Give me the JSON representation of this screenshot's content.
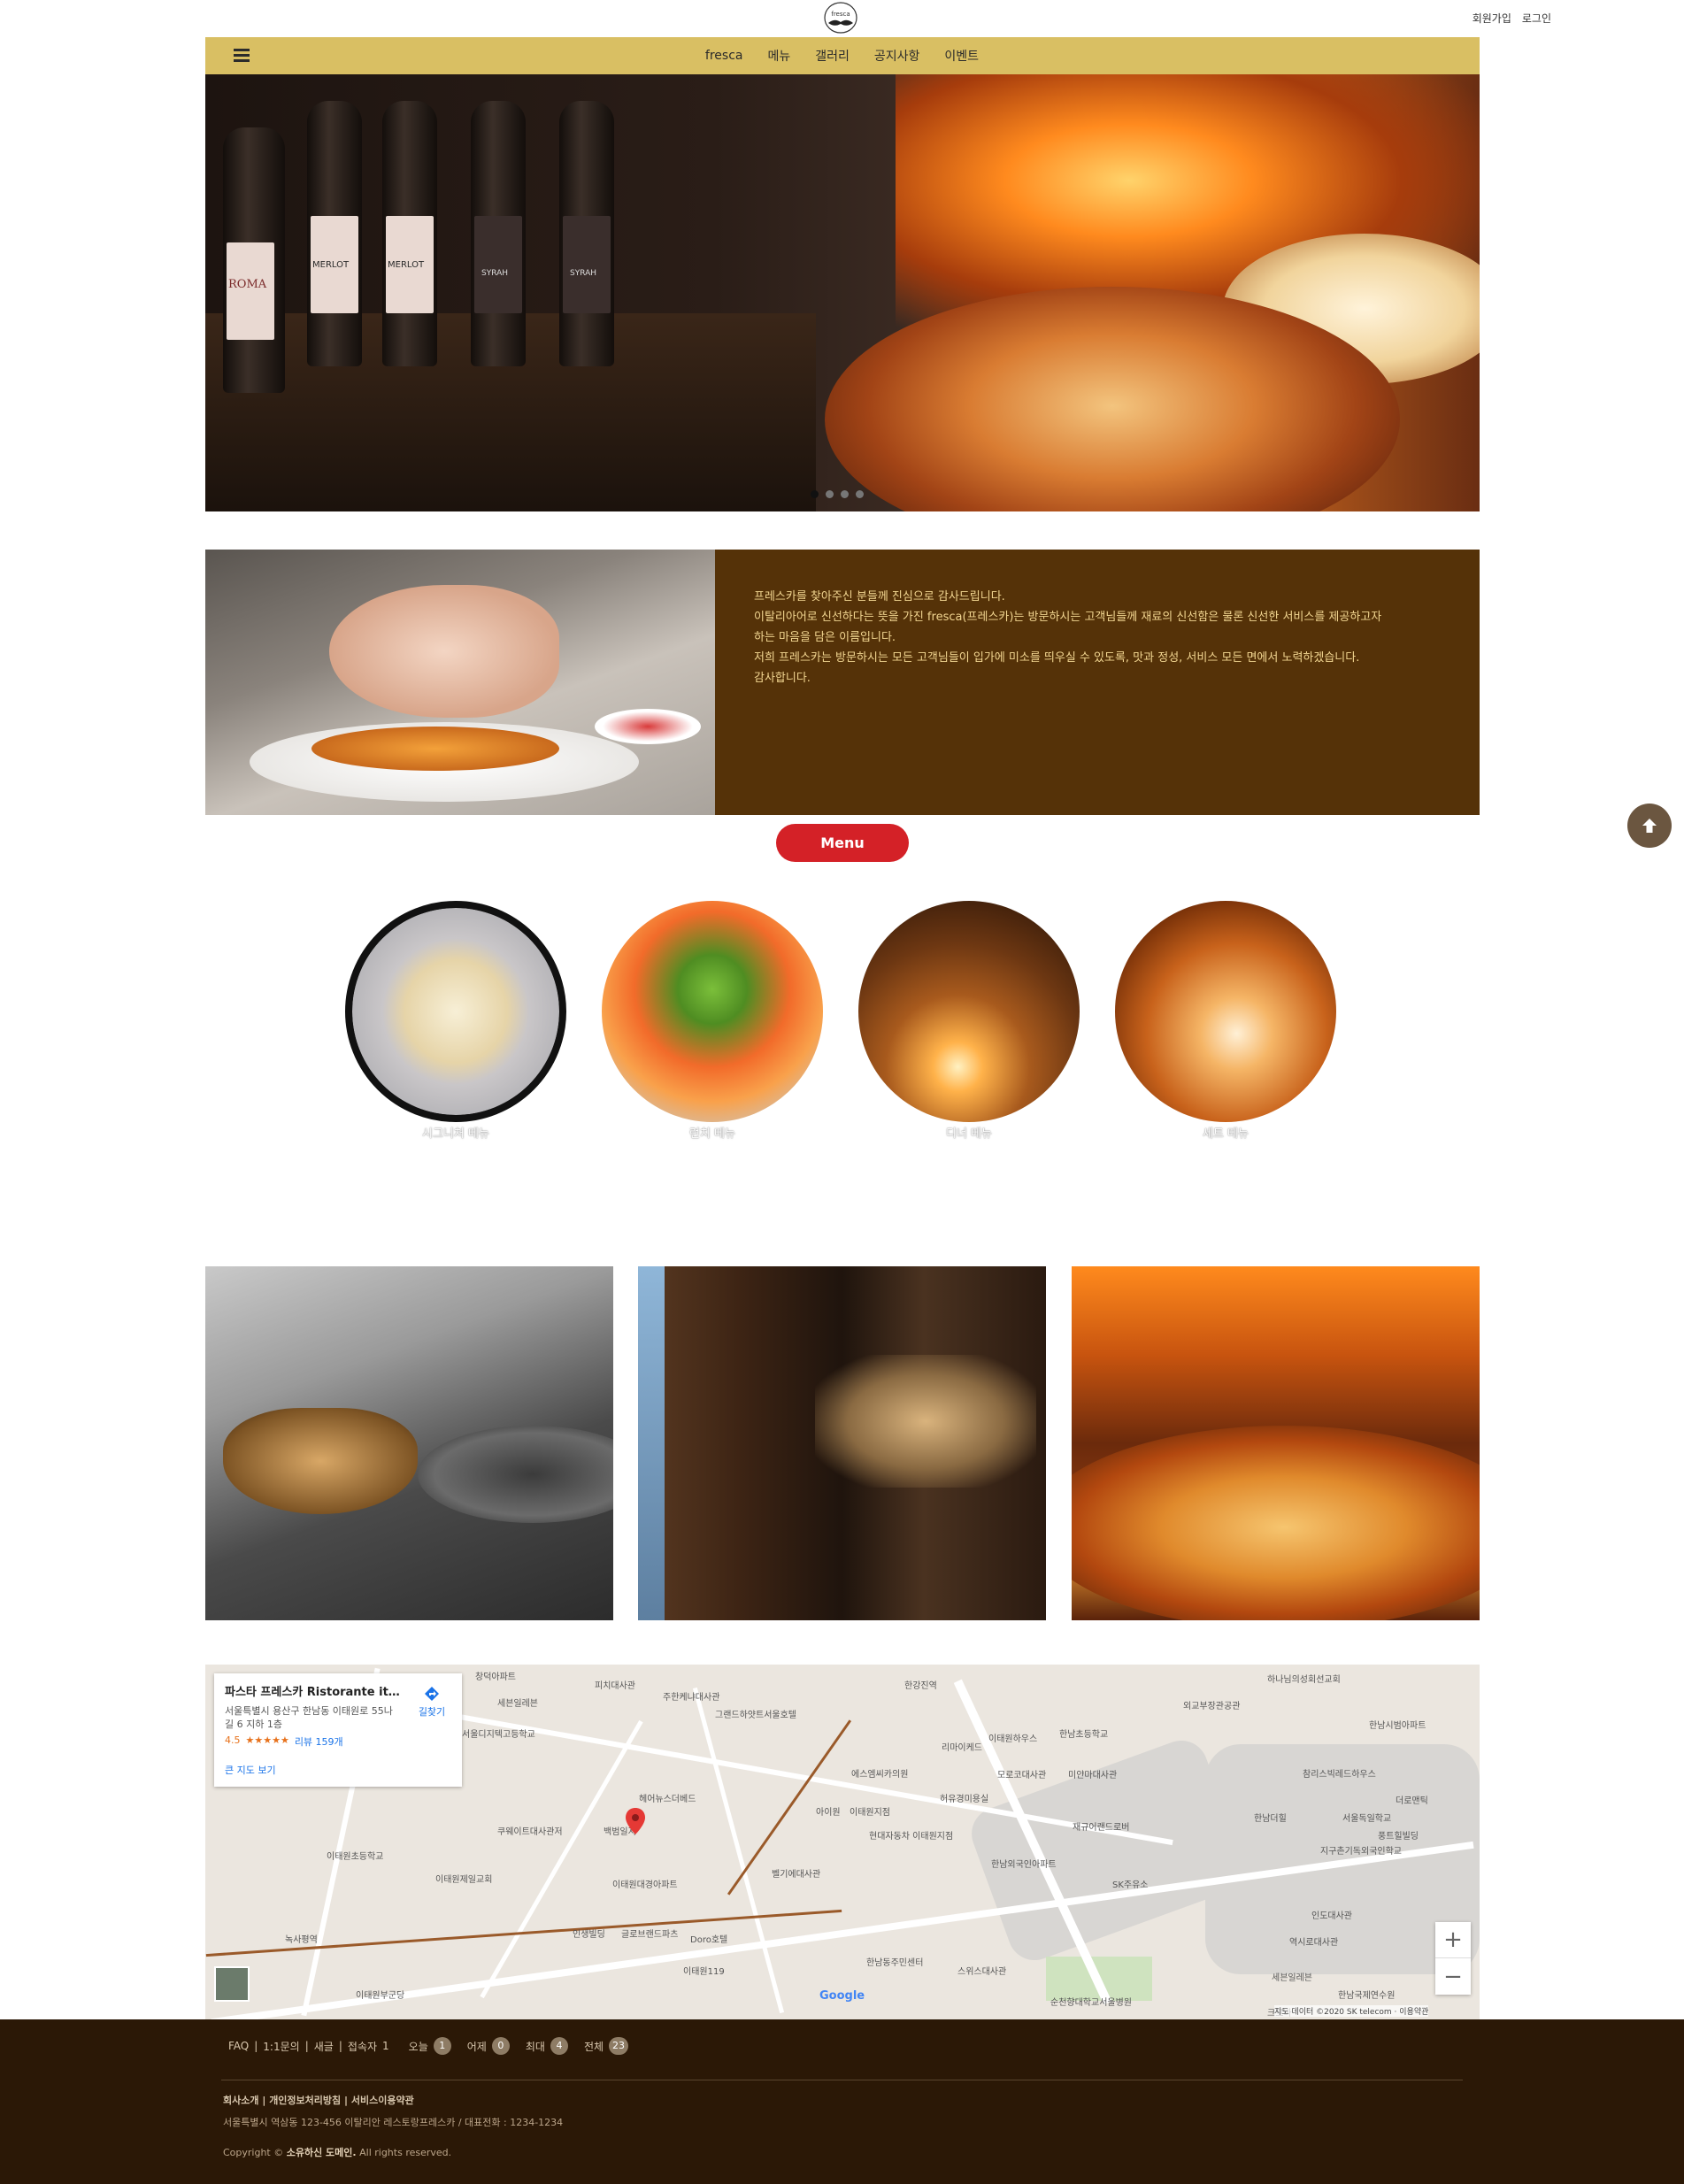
{
  "header": {
    "logo_text": "fresca",
    "top_links": [
      "회원가입",
      "로그인"
    ],
    "nav": [
      "fresca",
      "메뉴",
      "갤러리",
      "공지사항",
      "이벤트"
    ]
  },
  "hero": {
    "slides": 4,
    "active_slide": 1,
    "bottle_labels": [
      "ROMA",
      "MERLOT",
      "MERLOT",
      "SYRAH",
      "SYRAH"
    ]
  },
  "about": {
    "lines": [
      "프레스카를 찾아주신 분들께 진심으로 감사드립니다.",
      "이탈리아어로 신선하다는 뜻을 가진 fresca(프레스카)는 방문하시는 고객님들께 재료의 신선함은 물론 신선한 서비스를 제공하고자",
      "하는 마음을 담은 이름입니다.",
      "저희 프레스카는 방문하시는 모든 고객님들이 입가에 미소를 띄우실 수 있도록, 맛과 정성, 서비스 모든 면에서 노력하겠습니다.",
      "감사합니다."
    ]
  },
  "menu": {
    "button_label": "Menu",
    "items": [
      "시그니처 메뉴",
      "런치 메뉴",
      "디너 메뉴",
      "세트 메뉴"
    ]
  },
  "map": {
    "place_title": "파스타 프레스카 Ristorante ita...",
    "address": "서울특별시 용산구 한남동 이태원로 55나길 6 지하 1층",
    "rating": "4.5",
    "stars": "★★★★★",
    "reviews": "리뷰 159개",
    "directions": "길찾기",
    "larger_map": "큰 지도 보기",
    "google": "Google",
    "attribution": "지도 데이터 ©2020 SK telecom · 이용약관",
    "labels": [
      "창덕아파트",
      "피치대사관",
      "주한케냐대사관",
      "한강진역",
      "그랜드하얏트서울호텔",
      "외교부장관공관",
      "하나님의성회선교회",
      "세븐일레븐",
      "한남시범아파트",
      "서울디지텍고등학교",
      "한남초등학교",
      "리마이케드",
      "이태원하우스",
      "모로코대사관",
      "미얀마대사관",
      "에스엠씨카의원",
      "허유경미용실",
      "이태원초등학교",
      "쿠웨이트대사관저",
      "백범일지",
      "헤어뉴스더베드",
      "아이원",
      "이태원지점",
      "현대자동차 이태원지점",
      "한남외국인아파트",
      "재규어랜드로버",
      "SK주유소",
      "이태원제일교회",
      "벨기에대사관",
      "이태원대경아파트",
      "녹사평역",
      "이태원119",
      "한남동주민센터",
      "스위스대사관",
      "순천향대학교서울병원",
      "인도대사관",
      "역시로대사관",
      "세븐일레븐",
      "한남국제연수원",
      "크로바",
      "이태원부군당",
      "인생빌딩",
      "글로브랜드파츠",
      "Doro호텔",
      "한남더힐",
      "서울독일학교",
      "지구촌기독외국인학교",
      "더로맨틱",
      "풍트힐빌딩",
      "참리스빅레드하우스"
    ]
  },
  "footer": {
    "stats": [
      {
        "label": "FAQ",
        "sep": true
      },
      {
        "label": "1:1문의",
        "sep": true
      },
      {
        "label": "새글",
        "sep": true
      },
      {
        "label": "접속자",
        "value": "1"
      }
    ],
    "counters": [
      {
        "label": "오늘",
        "value": "1"
      },
      {
        "label": "어제",
        "value": "0"
      },
      {
        "label": "최대",
        "value": "4"
      },
      {
        "label": "전체",
        "value": "23"
      }
    ],
    "links": [
      "회사소개",
      "개인정보처리방침",
      "서비스이용약관"
    ],
    "address": "서울특별시 역삼동 123-456 이탈리안 레스토랑프레스카 / 대표전화 : 1234-1234",
    "copyright_prefix": "Copyright ©",
    "copyright_domain": "소유하신 도메인.",
    "copyright_suffix": "All rights reserved."
  }
}
